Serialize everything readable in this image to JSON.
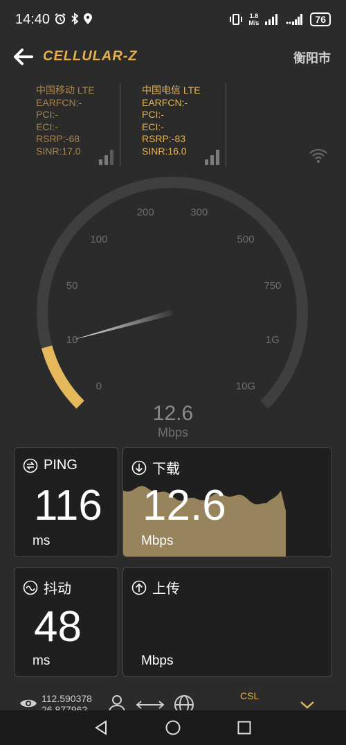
{
  "status_bar": {
    "time": "14:40",
    "speed_value": "1.8",
    "speed_unit": "M/s",
    "battery": "76"
  },
  "header": {
    "app_name": "CELLULAR-Z",
    "city": "衡阳市"
  },
  "carriers": [
    {
      "name": "中国移动 LTE",
      "earfcn": "EARFCN:-",
      "pci": "PCI:-",
      "eci": "ECI:-",
      "rsrp": "RSRP:-68",
      "sinr": "SINR:17.0"
    },
    {
      "name": "中国电信 LTE",
      "earfcn": "EARFCN:-",
      "pci": "PCI:-",
      "eci": "ECI:-",
      "rsrp": "RSRP:-83",
      "sinr": "SINR:16.0"
    }
  ],
  "gauge": {
    "ticks": [
      "0",
      "10",
      "50",
      "100",
      "200",
      "300",
      "500",
      "750",
      "1G",
      "10G"
    ],
    "value": "12.6",
    "unit": "Mbps",
    "level_fraction": 0.11
  },
  "cards": {
    "ping": {
      "label": "PING",
      "value": "116",
      "unit": "ms"
    },
    "download": {
      "label": "下载",
      "value": "12.6",
      "unit": "Mbps"
    },
    "jitter": {
      "label": "抖动",
      "value": "48",
      "unit": "ms"
    },
    "upload": {
      "label": "上传",
      "value": "",
      "unit": "Mbps"
    }
  },
  "info_bar": {
    "longitude": "112.590378",
    "latitude": "26.877962",
    "operator": "CSL"
  },
  "colors": {
    "accent": "#e8b04a",
    "carrier1": "#a8874e",
    "gauge_fill": "#e6b85c",
    "gauge_track": "#3f3f3f",
    "download_area": "#97845c"
  },
  "icons": {
    "back": "arrow-left-icon",
    "signal": "signal-bars-icon",
    "wifi": "wifi-icon",
    "ping": "ping-icon",
    "download": "download-icon",
    "jitter": "jitter-icon",
    "upload": "upload-icon",
    "eye": "eye-icon",
    "person": "person-icon",
    "transfer": "transfer-icon",
    "globe": "globe-icon",
    "chevron": "chevron-down-icon"
  }
}
